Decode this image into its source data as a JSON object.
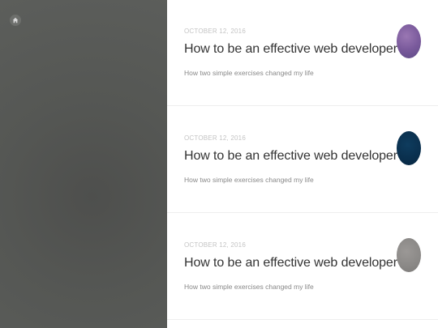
{
  "sidebar": {
    "home_icon": "home-icon"
  },
  "posts": [
    {
      "date": "OCTOBER 12, 2016",
      "title": "How to be an effective web developer",
      "subtitle": "How two simple exercises changed my life",
      "thumb_color": "#7a5a9c"
    },
    {
      "date": "OCTOBER 12, 2016",
      "title": "How to be an effective web developer",
      "subtitle": "How two simple exercises changed my life",
      "thumb_color": "#0a2f4d"
    },
    {
      "date": "OCTOBER 12, 2016",
      "title": "How to be an effective web developer",
      "subtitle": "How two simple exercises changed my life",
      "thumb_color": "#8a8886"
    }
  ],
  "colors": {
    "sidebar_bg": "#555754",
    "title_text": "#333333",
    "subtitle_text": "#888888",
    "date_text": "#c4c4c4"
  }
}
